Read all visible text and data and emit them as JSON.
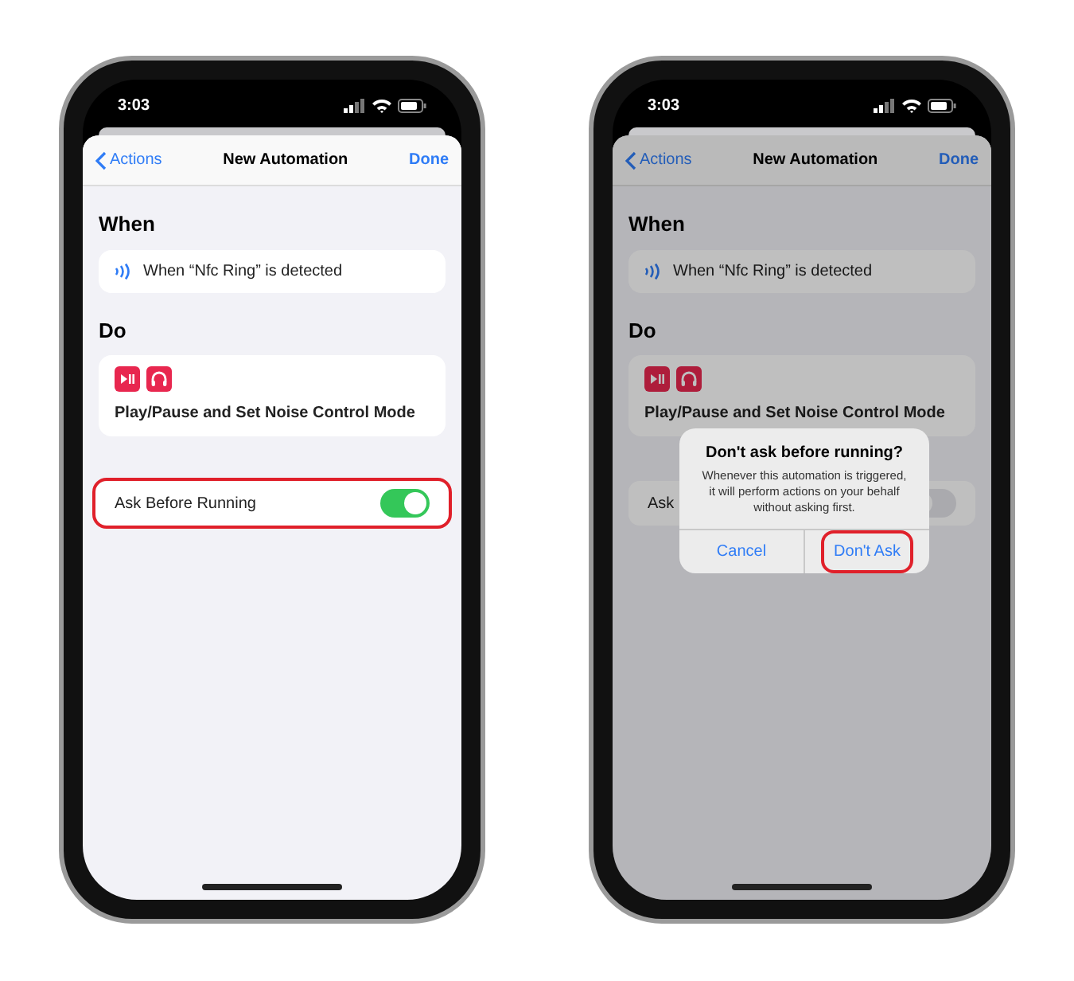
{
  "phones": [
    {
      "status_time": "3:03",
      "nav": {
        "back": "Actions",
        "title": "New Automation",
        "done": "Done"
      },
      "sections": [
        {
          "heading": "When",
          "kind": "trigger",
          "text": "When “Nfc Ring” is detected"
        },
        {
          "heading": "Do",
          "kind": "action",
          "text": "Play/Pause and Set Noise Control Mode"
        }
      ],
      "toggle_row": {
        "label": "Ask Before Running",
        "on": true,
        "highlighted": true
      },
      "dimmed": false
    },
    {
      "status_time": "3:03",
      "nav": {
        "back": "Actions",
        "title": "New Automation",
        "done": "Done"
      },
      "sections": [
        {
          "heading": "When",
          "kind": "trigger",
          "text": "When “Nfc Ring” is detected"
        },
        {
          "heading": "Do",
          "kind": "action",
          "text": "Play/Pause and Set Noise Control Mode"
        }
      ],
      "toggle_row": {
        "label": "Ask",
        "on": false,
        "highlighted": false
      },
      "dimmed": true,
      "alert": {
        "title": "Don't ask before running?",
        "message": "Whenever this automation is triggered, it will perform actions on your behalf without asking first.",
        "buttons": [
          {
            "label": "Cancel",
            "highlighted": false
          },
          {
            "label": "Don't Ask",
            "highlighted": true
          }
        ]
      }
    }
  ]
}
